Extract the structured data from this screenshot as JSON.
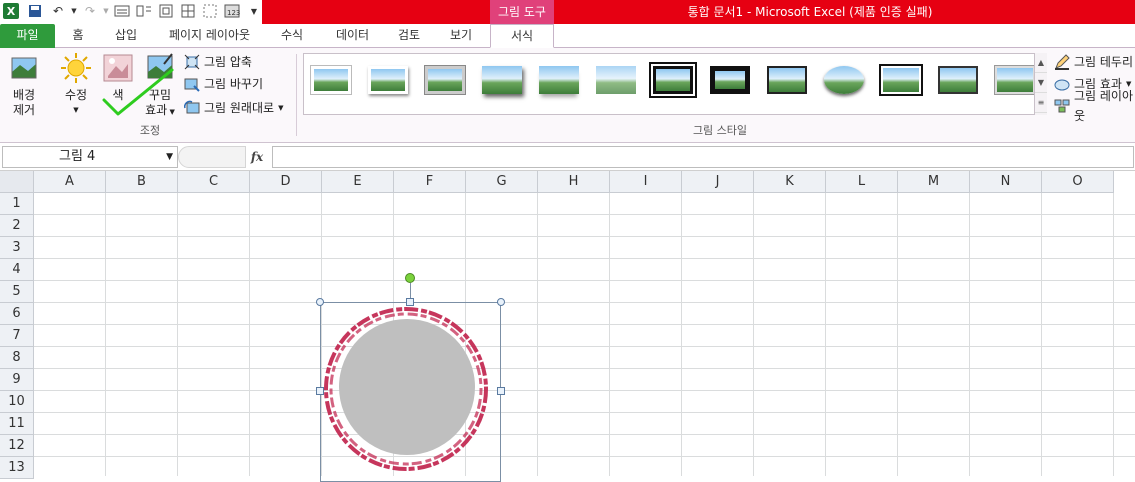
{
  "title_bar": {
    "context_tab_head": "그림 도구",
    "document_title": "통합 문서1  -  Microsoft Excel (제품 인증 실패)"
  },
  "tabs": [
    {
      "label": "파일"
    },
    {
      "label": "홈"
    },
    {
      "label": "삽입"
    },
    {
      "label": "페이지 레이아웃"
    },
    {
      "label": "수식"
    },
    {
      "label": "데이터"
    },
    {
      "label": "검토"
    },
    {
      "label": "보기"
    },
    {
      "label": "서식"
    }
  ],
  "ribbon": {
    "adjust": {
      "remove_bg_line1": "배경",
      "remove_bg_line2": "제거",
      "corrections": "수정",
      "color": "색",
      "artistic_line1": "꾸밈",
      "artistic_line2": "효과",
      "compress": "그림 압축",
      "change": "그림 바꾸기",
      "reset": "그림 원래대로",
      "group_label": "조정"
    },
    "styles": {
      "group_label": "그림 스타일",
      "border": "그림 테두리",
      "effects": "그림 효과",
      "layout": "그림 레이아웃"
    }
  },
  "formula_bar": {
    "name_box": "그림 4",
    "fx": "fx",
    "formula": ""
  },
  "grid": {
    "columns": [
      "A",
      "B",
      "C",
      "D",
      "E",
      "F",
      "G",
      "H",
      "I",
      "J",
      "K",
      "L",
      "M",
      "N",
      "O"
    ],
    "rows": [
      "1",
      "2",
      "3",
      "4",
      "5",
      "6",
      "7",
      "8",
      "9",
      "10",
      "11",
      "12",
      "13"
    ]
  },
  "colors": {
    "title_red": "#e60012",
    "context_pink": "#e0417a",
    "file_green": "#2f9b3c",
    "stamp_red": "#c0204a",
    "stamp_fill": "#bfbfbf",
    "checkmark_green": "#2ecc1f"
  }
}
